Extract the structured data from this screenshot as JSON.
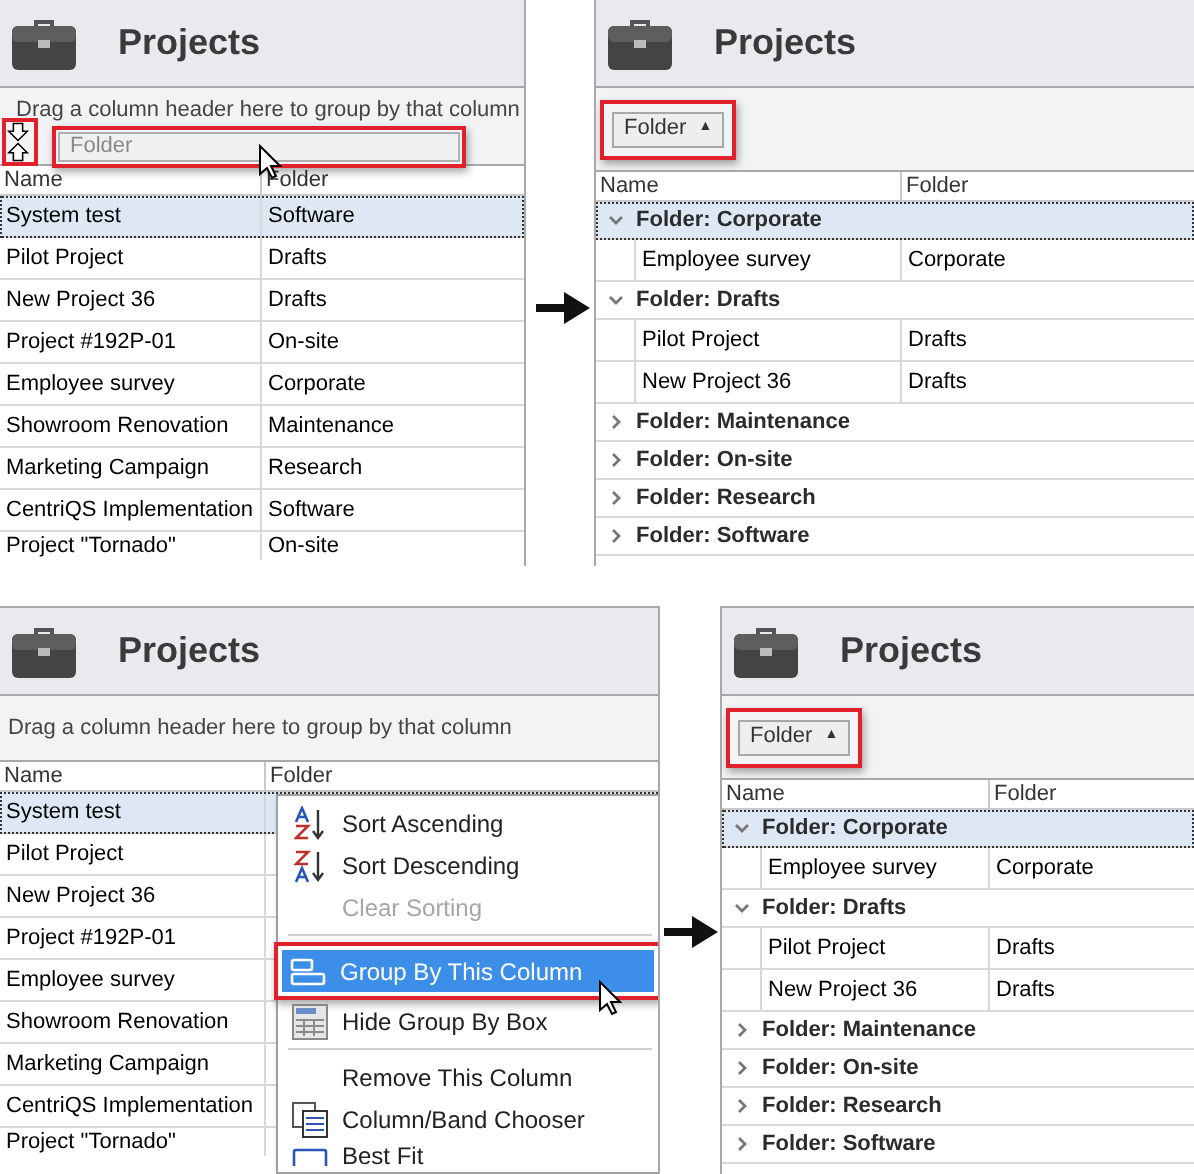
{
  "panels": [
    {
      "kind": "drag",
      "title": "Projects",
      "group_hint": "Drag a column header here to group by that column",
      "drag_ghost": "Folder",
      "columns": [
        "Name",
        "Folder"
      ],
      "rows": [
        {
          "cells": [
            "System test",
            "Software"
          ],
          "selected": true
        },
        {
          "cells": [
            "Pilot Project",
            "Drafts"
          ],
          "selected": false
        },
        {
          "cells": [
            "New Project 36",
            "Drafts"
          ],
          "selected": false
        },
        {
          "cells": [
            "Project #192P-01",
            "On-site"
          ],
          "selected": false
        },
        {
          "cells": [
            "Employee survey",
            "Corporate"
          ],
          "selected": false
        },
        {
          "cells": [
            "Showroom Renovation",
            "Maintenance"
          ],
          "selected": false
        },
        {
          "cells": [
            "Marketing Campaign",
            "Research"
          ],
          "selected": false
        },
        {
          "cells": [
            "CentriQS Implementation",
            "Software"
          ],
          "selected": false
        },
        {
          "cells": [
            "Project \"Tornado\"",
            "On-site"
          ],
          "selected": false
        }
      ]
    },
    {
      "kind": "grouped",
      "title": "Projects",
      "group_chip": {
        "label": "Folder",
        "sort": "▲"
      },
      "columns": [
        "Name",
        "Folder"
      ],
      "groups": [
        {
          "label": "Folder: Corporate",
          "expanded": true,
          "selected": true,
          "rows": [
            [
              "Employee survey",
              "Corporate"
            ]
          ]
        },
        {
          "label": "Folder: Drafts",
          "expanded": true,
          "selected": false,
          "rows": [
            [
              "Pilot Project",
              "Drafts"
            ],
            [
              "New Project 36",
              "Drafts"
            ]
          ]
        },
        {
          "label": "Folder: Maintenance",
          "expanded": false,
          "selected": false
        },
        {
          "label": "Folder: On-site",
          "expanded": false,
          "selected": false
        },
        {
          "label": "Folder: Research",
          "expanded": false,
          "selected": false
        },
        {
          "label": "Folder: Software",
          "expanded": false,
          "selected": false
        }
      ]
    },
    {
      "kind": "menu",
      "title": "Projects",
      "group_hint": "Drag a column header here to group by that column",
      "columns": [
        "Name",
        "Folder"
      ],
      "rows": [
        {
          "cells": [
            "System test"
          ],
          "selected": true
        },
        {
          "cells": [
            "Pilot Project"
          ],
          "selected": false
        },
        {
          "cells": [
            "New Project 36"
          ],
          "selected": false
        },
        {
          "cells": [
            "Project #192P-01"
          ],
          "selected": false
        },
        {
          "cells": [
            "Employee survey"
          ],
          "selected": false
        },
        {
          "cells": [
            "Showroom Renovation"
          ],
          "selected": false
        },
        {
          "cells": [
            "Marketing Campaign"
          ],
          "selected": false
        },
        {
          "cells": [
            "CentriQS Implementation"
          ],
          "selected": false
        },
        {
          "cells": [
            "Project \"Tornado\""
          ],
          "selected": false
        }
      ],
      "menu": [
        {
          "kind": "item",
          "label": "Sort Ascending",
          "disabled": false,
          "selected": false
        },
        {
          "kind": "item",
          "label": "Sort Descending",
          "disabled": false,
          "selected": false
        },
        {
          "kind": "item",
          "label": "Clear Sorting",
          "disabled": true,
          "selected": false
        },
        {
          "kind": "separator"
        },
        {
          "kind": "item",
          "label": "Group By This Column",
          "disabled": false,
          "selected": true
        },
        {
          "kind": "item",
          "label": "Hide Group By Box",
          "disabled": false,
          "selected": false
        },
        {
          "kind": "separator"
        },
        {
          "kind": "item",
          "label": "Remove This Column",
          "disabled": false,
          "selected": false
        },
        {
          "kind": "item",
          "label": "Column/Band Chooser",
          "disabled": false,
          "selected": false
        },
        {
          "kind": "item",
          "label": "Best Fit",
          "disabled": false,
          "selected": false
        }
      ]
    },
    {
      "kind": "grouped",
      "title": "Projects",
      "group_chip": {
        "label": "Folder",
        "sort": "▲"
      },
      "columns": [
        "Name",
        "Folder"
      ],
      "groups": [
        {
          "label": "Folder: Corporate",
          "expanded": true,
          "selected": true,
          "rows": [
            [
              "Employee survey",
              "Corporate"
            ]
          ]
        },
        {
          "label": "Folder: Drafts",
          "expanded": true,
          "selected": false,
          "rows": [
            [
              "Pilot Project",
              "Drafts"
            ],
            [
              "New Project 36",
              "Drafts"
            ]
          ]
        },
        {
          "label": "Folder: Maintenance",
          "expanded": false,
          "selected": false
        },
        {
          "label": "Folder: On-site",
          "expanded": false,
          "selected": false
        },
        {
          "label": "Folder: Research",
          "expanded": false,
          "selected": false
        },
        {
          "label": "Folder: Software",
          "expanded": false,
          "selected": false
        }
      ]
    }
  ]
}
